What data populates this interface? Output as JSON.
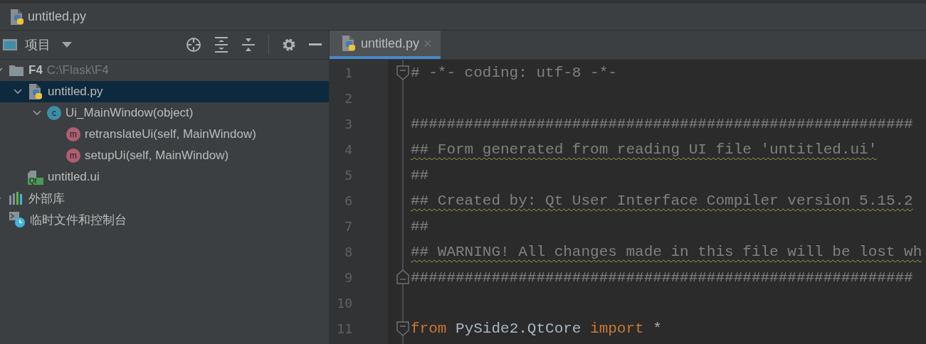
{
  "breadcrumb": {
    "file": "untitled.py"
  },
  "project_panel": {
    "title": "项目",
    "tree": [
      {
        "label": "F4",
        "path": "C:\\Flask\\F4",
        "kind": "folder",
        "expanded": true,
        "selected": false,
        "children": [
          {
            "label": "untitled.py",
            "kind": "python",
            "expanded": true,
            "selected": true,
            "children": [
              {
                "label": "Ui_MainWindow(object)",
                "kind": "class",
                "badge": "c",
                "expanded": true,
                "selected": false,
                "children": [
                  {
                    "label": "retranslateUi(self, MainWindow)",
                    "kind": "method",
                    "badge": "m",
                    "selected": false
                  },
                  {
                    "label": "setupUi(self, MainWindow)",
                    "kind": "method",
                    "badge": "m",
                    "selected": false
                  }
                ]
              }
            ]
          },
          {
            "label": "untitled.ui",
            "kind": "qt",
            "badge": "Qt",
            "selected": false
          }
        ]
      },
      {
        "label": "外部库",
        "kind": "library",
        "expanded": false,
        "selected": false
      },
      {
        "label": "临时文件和控制台",
        "kind": "scratch",
        "selected": false
      }
    ]
  },
  "editor": {
    "tabs": [
      {
        "label": "untitled.py",
        "close": "×",
        "selected": true
      }
    ],
    "lines": [
      {
        "number": "1",
        "fold_start": true,
        "fold_end": false,
        "underlined": false,
        "tokens": [
          {
            "kind": "comment",
            "text": "# -*- coding: utf-8 -*-"
          }
        ]
      },
      {
        "number": "2",
        "fold_start": false,
        "fold_end": false
      },
      {
        "number": "3",
        "fold_start": false,
        "fold_end": false,
        "underlined": false,
        "tokens": [
          {
            "kind": "comment",
            "text": "########################################################"
          }
        ]
      },
      {
        "number": "4",
        "fold_start": false,
        "fold_end": false,
        "underlined": true,
        "tokens": [
          {
            "kind": "comment",
            "text": "## Form generated from reading UI file 'untitled.ui'"
          }
        ]
      },
      {
        "number": "5",
        "fold_start": false,
        "fold_end": false,
        "underlined": false,
        "tokens": [
          {
            "kind": "comment",
            "text": "##"
          }
        ]
      },
      {
        "number": "6",
        "fold_start": false,
        "fold_end": false,
        "underlined": true,
        "tokens": [
          {
            "kind": "comment",
            "text": "## Created by: Qt User Interface Compiler version 5.15.2"
          }
        ]
      },
      {
        "number": "7",
        "fold_start": false,
        "fold_end": false,
        "underlined": false,
        "tokens": [
          {
            "kind": "comment",
            "text": "##"
          }
        ]
      },
      {
        "number": "8",
        "fold_start": false,
        "fold_end": false,
        "underlined": true,
        "tokens": [
          {
            "kind": "comment",
            "text": "## WARNING! All changes made in this file will be lost wh"
          }
        ]
      },
      {
        "number": "9",
        "fold_start": false,
        "fold_end": true,
        "underlined": false,
        "tokens": [
          {
            "kind": "comment",
            "text": "########################################################"
          }
        ]
      },
      {
        "number": "10",
        "fold_start": false,
        "fold_end": false
      },
      {
        "number": "11",
        "fold_start": true,
        "fold_end": false,
        "underlined": false,
        "tokens": [
          {
            "kind": "keyword",
            "text": "from"
          },
          {
            "kind": "plain",
            "text": " PySide2.QtCore "
          },
          {
            "kind": "keyword",
            "text": "import"
          },
          {
            "kind": "plain",
            "text": " *"
          }
        ]
      }
    ]
  }
}
